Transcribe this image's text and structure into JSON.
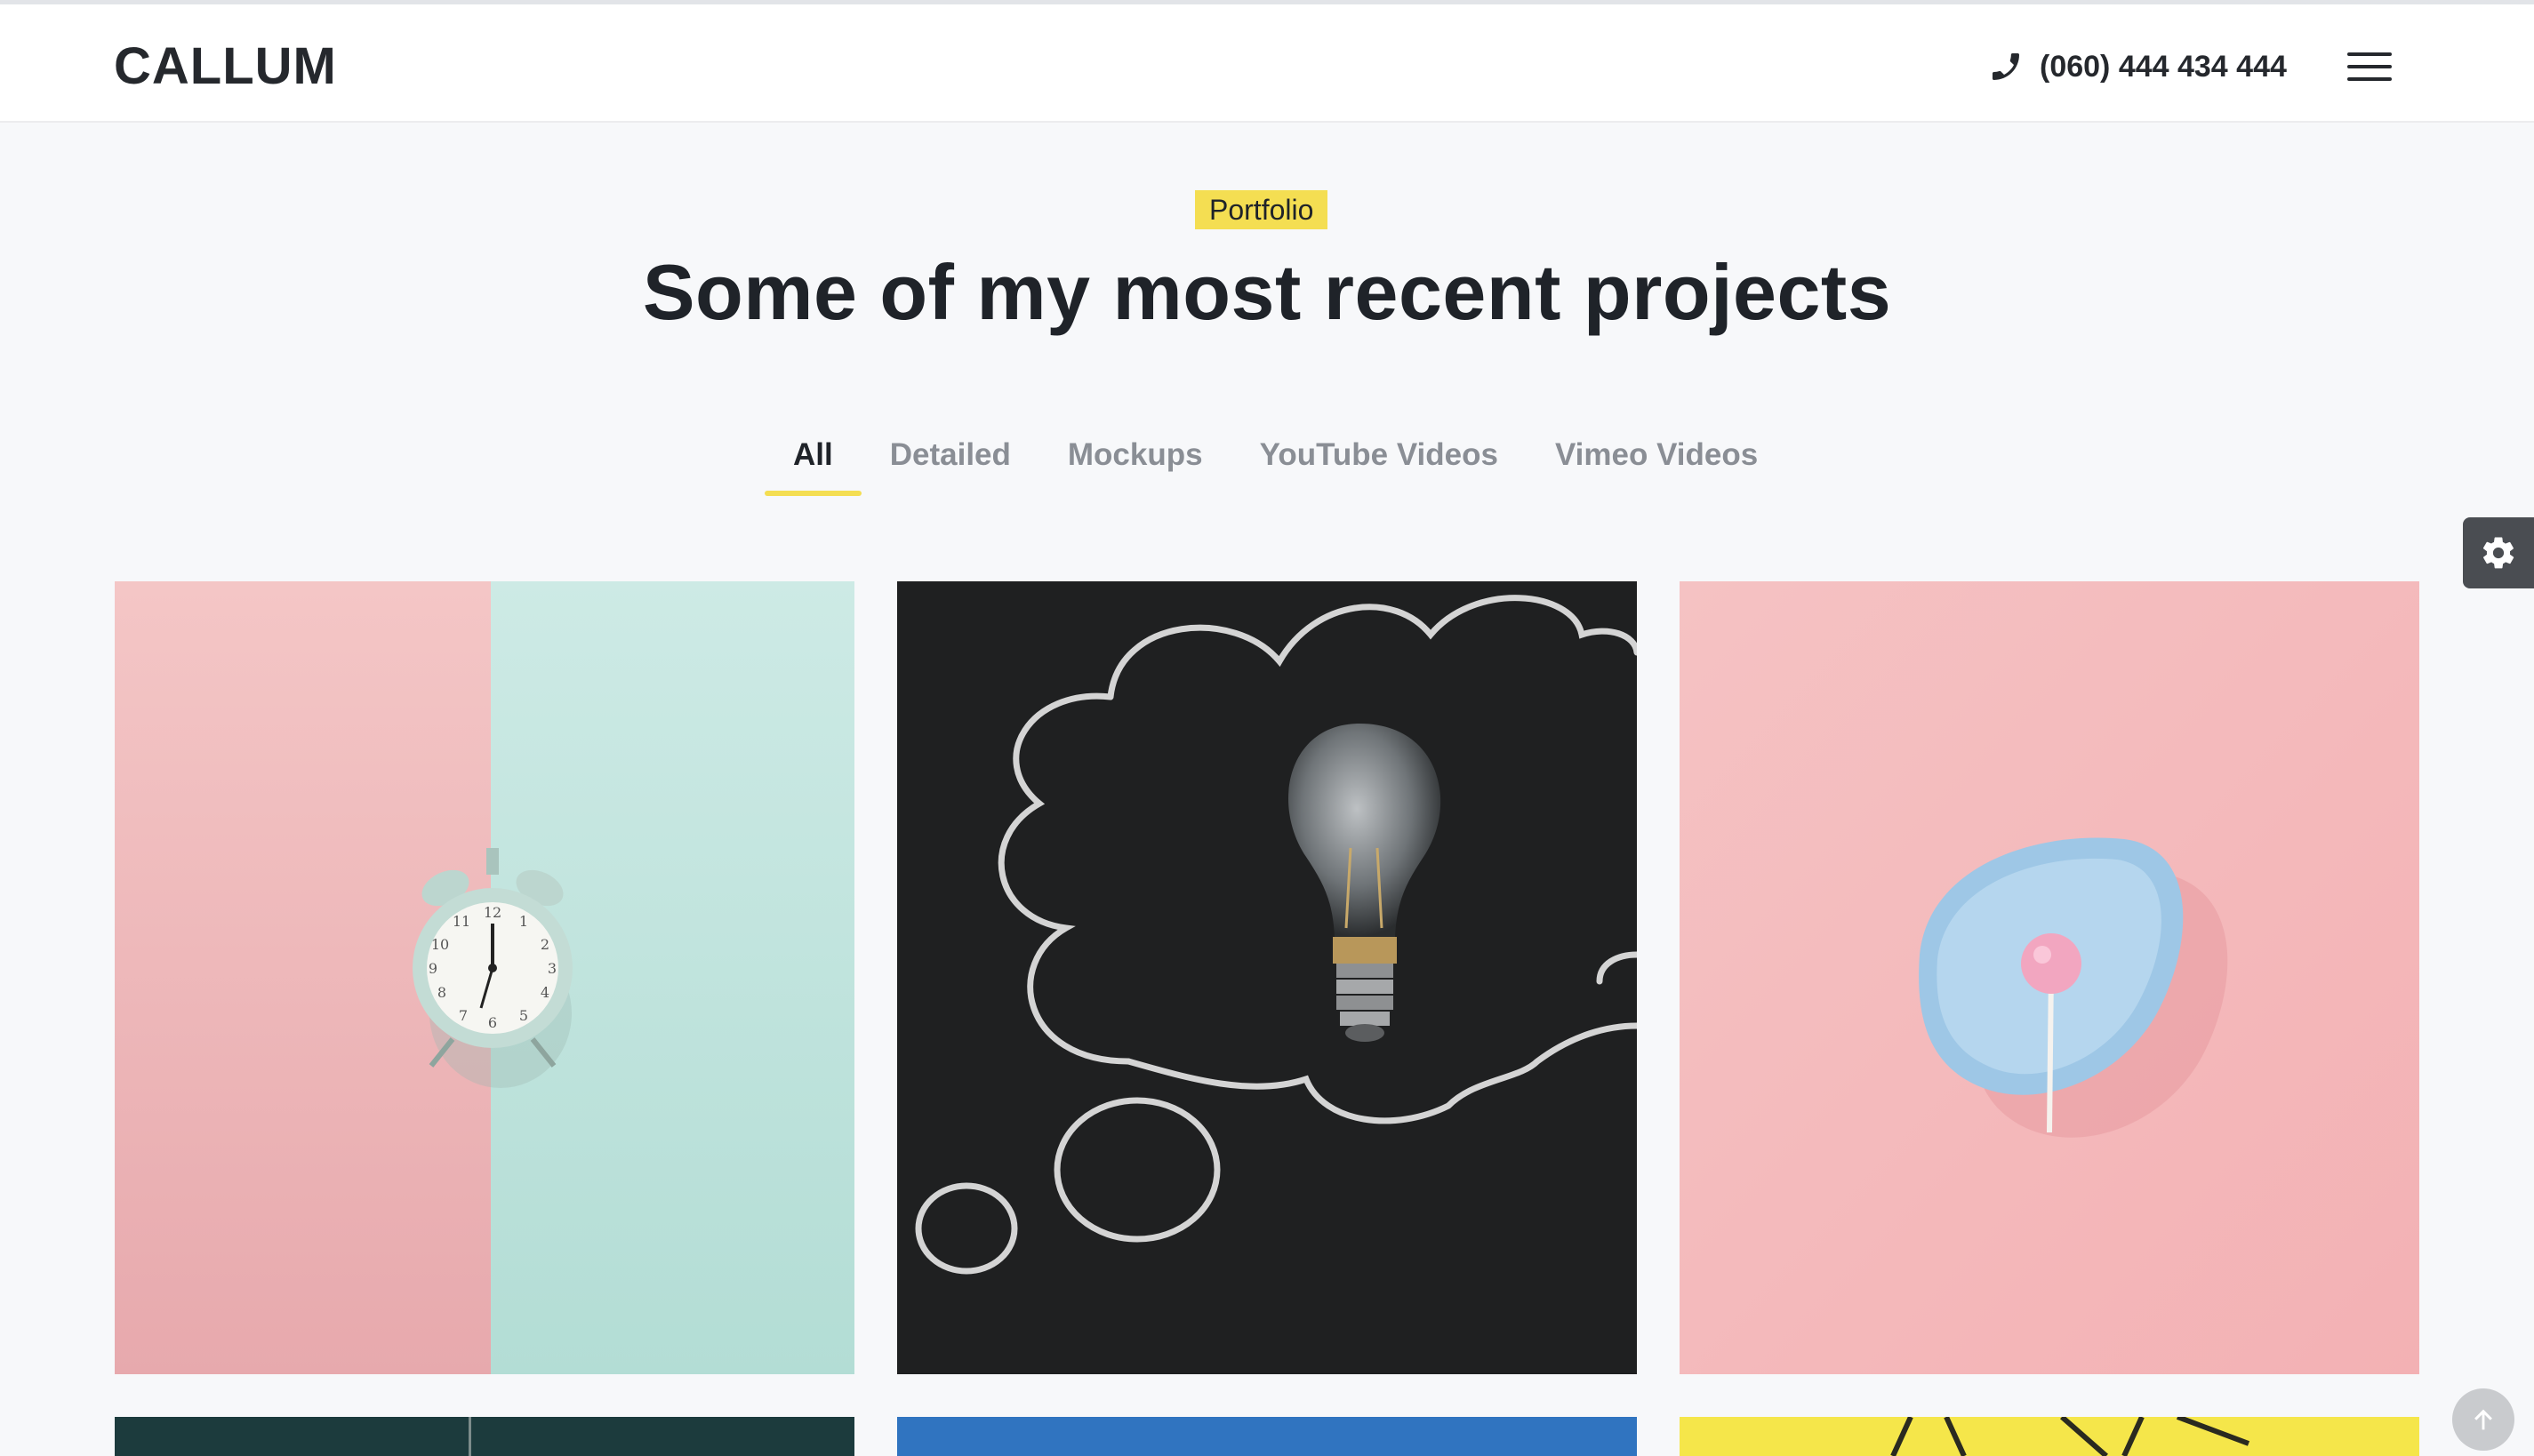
{
  "brand": {
    "logo_text": "CALLUM"
  },
  "header": {
    "phone_icon": "phone-icon",
    "phone_number": "(060) 444 434 444",
    "menu_icon": "hamburger-menu-icon"
  },
  "portfolio": {
    "tag": "Portfolio",
    "title": "Some of my most recent projects",
    "filters": [
      {
        "label": "All",
        "active": true
      },
      {
        "label": "Detailed",
        "active": false
      },
      {
        "label": "Mockups",
        "active": false
      },
      {
        "label": "YouTube Videos",
        "active": false
      },
      {
        "label": "Vimeo Videos",
        "active": false
      }
    ],
    "items": [
      {
        "image": "alarm-clock-on-pink-and-mint-background"
      },
      {
        "image": "light-bulb-on-chalkboard-thought-cloud"
      },
      {
        "image": "pink-lollipop-on-blue-plate"
      },
      {
        "image": "dark-teal-image"
      },
      {
        "image": "blue-image"
      },
      {
        "image": "yellow-image"
      }
    ]
  },
  "colors": {
    "accent": "#f4de52",
    "text": "#1f2329",
    "muted": "#8a8e95",
    "background": "#f7f8fa"
  },
  "widgets": {
    "settings_icon": "gear-icon",
    "scroll_top_icon": "arrow-up-icon"
  }
}
